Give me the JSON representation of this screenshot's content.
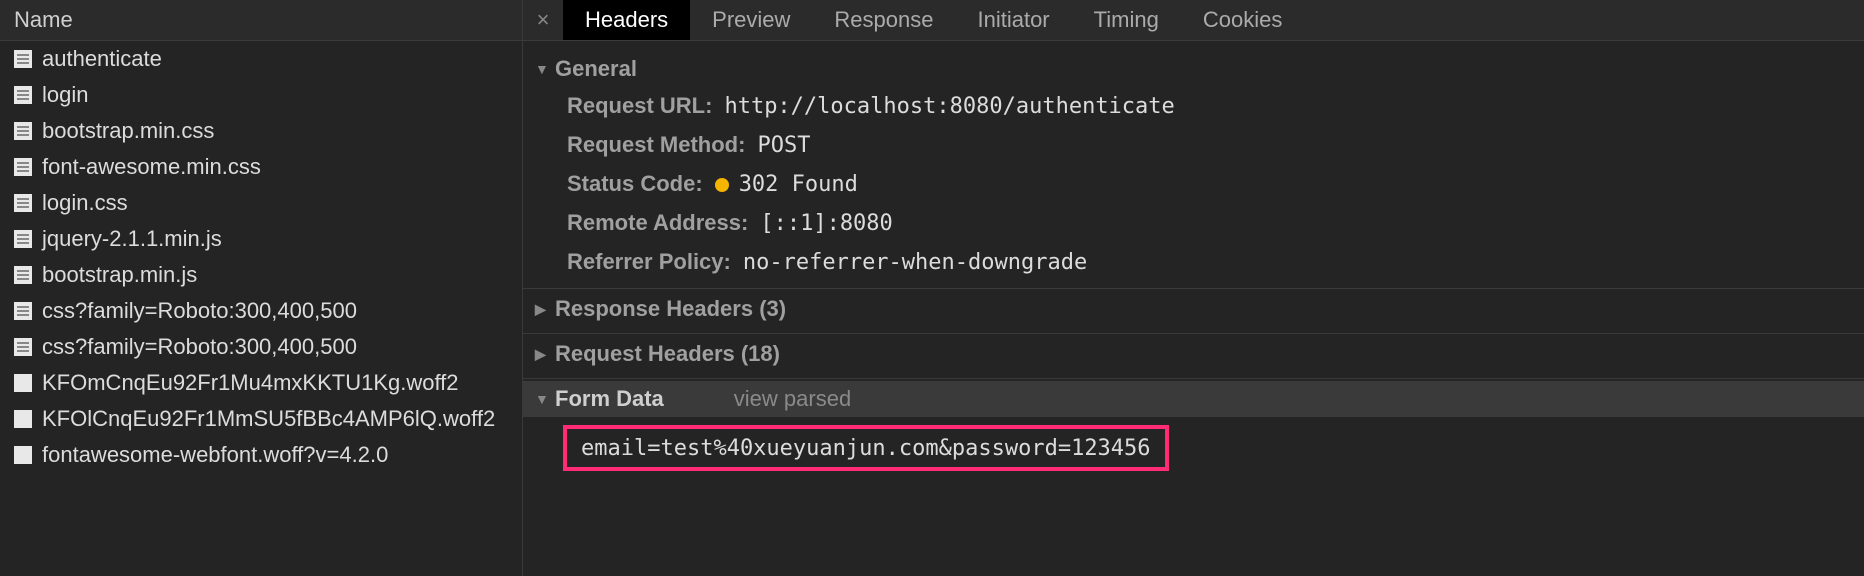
{
  "left": {
    "header": "Name",
    "files": [
      {
        "name": "authenticate",
        "icon": "doc"
      },
      {
        "name": "login",
        "icon": "doc"
      },
      {
        "name": "bootstrap.min.css",
        "icon": "css"
      },
      {
        "name": "font-awesome.min.css",
        "icon": "css"
      },
      {
        "name": "login.css",
        "icon": "css"
      },
      {
        "name": "jquery-2.1.1.min.js",
        "icon": "js"
      },
      {
        "name": "bootstrap.min.js",
        "icon": "js"
      },
      {
        "name": "css?family=Roboto:300,400,500",
        "icon": "css"
      },
      {
        "name": "css?family=Roboto:300,400,500",
        "icon": "css"
      },
      {
        "name": "KFOmCnqEu92Fr1Mu4mxKKTU1Kg.woff2",
        "icon": "font"
      },
      {
        "name": "KFOlCnqEu92Fr1MmSU5fBBc4AMP6lQ.woff2",
        "icon": "font"
      },
      {
        "name": "fontawesome-webfont.woff?v=4.2.0",
        "icon": "font"
      }
    ]
  },
  "tabs": {
    "close": "×",
    "items": [
      "Headers",
      "Preview",
      "Response",
      "Initiator",
      "Timing",
      "Cookies"
    ],
    "active": 0
  },
  "general": {
    "title": "General",
    "request_url_k": "Request URL:",
    "request_url_v": "http://localhost:8080/authenticate",
    "request_method_k": "Request Method:",
    "request_method_v": "POST",
    "status_code_k": "Status Code:",
    "status_code_v": "302 Found",
    "remote_addr_k": "Remote Address:",
    "remote_addr_v": "[::1]:8080",
    "referrer_k": "Referrer Policy:",
    "referrer_v": "no-referrer-when-downgrade"
  },
  "response_headers": {
    "title": "Response Headers (3)"
  },
  "request_headers": {
    "title": "Request Headers (18)"
  },
  "form_data": {
    "title": "Form Data",
    "view_parsed": "view parsed",
    "payload": "email=test%40xueyuanjun.com&password=123456"
  }
}
